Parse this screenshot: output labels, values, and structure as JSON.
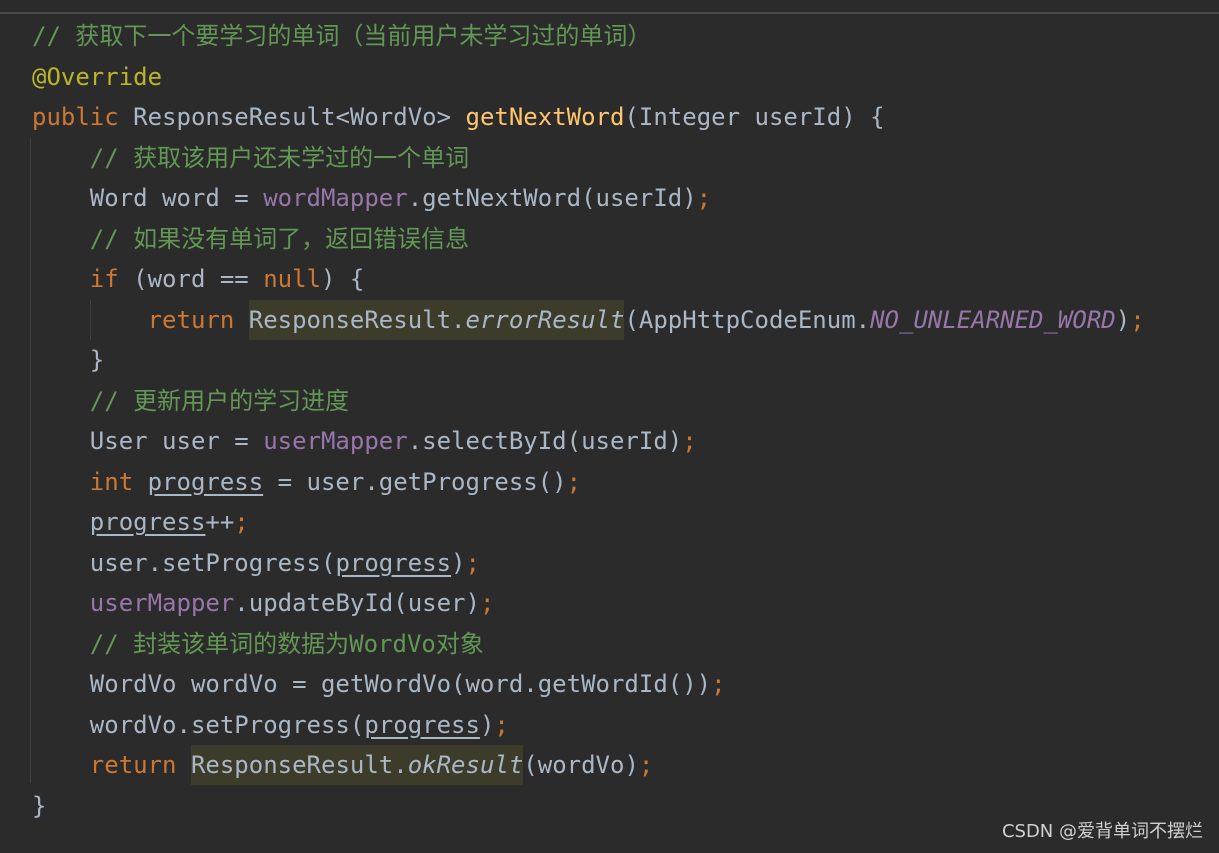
{
  "colors": {
    "background": "#2b2b2b",
    "keyword": "#cc7832",
    "comment": "#629755",
    "annotation": "#bbb529",
    "method_decl": "#ffc66d",
    "field": "#9876aa",
    "text": "#a9b7c6"
  },
  "code_lines": [
    [
      {
        "t": "// 获取下一个要学习的单词（当前用户未学习过的单词）",
        "c": "cm"
      }
    ],
    [
      {
        "t": "@Override",
        "c": "an"
      }
    ],
    [
      {
        "t": "public ",
        "c": "kw"
      },
      {
        "t": "ResponseResult<WordVo> "
      },
      {
        "t": "getNextWord",
        "c": "fn"
      },
      {
        "t": "(Integer userId) {"
      }
    ],
    [
      {
        "t": "    "
      },
      {
        "t": "// 获取该用户还未学过的一个单词",
        "c": "cm"
      }
    ],
    [
      {
        "t": "    Word word = "
      },
      {
        "t": "wordMapper",
        "c": "fld"
      },
      {
        "t": ".getNextWord(userId)"
      },
      {
        "t": ";",
        "c": "sm"
      }
    ],
    [
      {
        "t": "    "
      },
      {
        "t": "// 如果没有单词了，返回错误信息",
        "c": "cm"
      }
    ],
    [
      {
        "t": "    "
      },
      {
        "t": "if ",
        "c": "kw"
      },
      {
        "t": "(word == "
      },
      {
        "t": "null",
        "c": "kw"
      },
      {
        "t": ") {"
      }
    ],
    [
      {
        "t": "        "
      },
      {
        "t": "return ",
        "c": "kw"
      },
      {
        "t": "ResponseResult.",
        "c": "hl"
      },
      {
        "t": "errorResult",
        "c": "hl it"
      },
      {
        "t": "(AppHttpCodeEnum."
      },
      {
        "t": "NO_UNLEARNED_WORD",
        "c": "fld it"
      },
      {
        "t": ")"
      },
      {
        "t": ";",
        "c": "sm"
      }
    ],
    [
      {
        "t": "    }"
      }
    ],
    [
      {
        "t": "    "
      },
      {
        "t": "// 更新用户的学习进度",
        "c": "cm"
      }
    ],
    [
      {
        "t": "    User user = "
      },
      {
        "t": "userMapper",
        "c": "fld"
      },
      {
        "t": ".selectById(userId)"
      },
      {
        "t": ";",
        "c": "sm"
      }
    ],
    [
      {
        "t": "    "
      },
      {
        "t": "int ",
        "c": "kw"
      },
      {
        "t": "progress",
        "c": "ul"
      },
      {
        "t": " = user.getProgress()"
      },
      {
        "t": ";",
        "c": "sm"
      }
    ],
    [
      {
        "t": "    "
      },
      {
        "t": "progress",
        "c": "ul"
      },
      {
        "t": "++"
      },
      {
        "t": ";",
        "c": "sm"
      }
    ],
    [
      {
        "t": "    user.setProgress("
      },
      {
        "t": "progress",
        "c": "ul"
      },
      {
        "t": ")"
      },
      {
        "t": ";",
        "c": "sm"
      }
    ],
    [
      {
        "t": "    "
      },
      {
        "t": "userMapper",
        "c": "fld"
      },
      {
        "t": ".updateById(user)"
      },
      {
        "t": ";",
        "c": "sm"
      }
    ],
    [
      {
        "t": "    "
      },
      {
        "t": "// 封装该单词的数据为WordVo对象",
        "c": "cm"
      }
    ],
    [
      {
        "t": "    WordVo wordVo = getWordVo(word.getWordId())"
      },
      {
        "t": ";",
        "c": "sm"
      }
    ],
    [
      {
        "t": "    wordVo.setProgress("
      },
      {
        "t": "progress",
        "c": "ul"
      },
      {
        "t": ")"
      },
      {
        "t": ";",
        "c": "sm"
      }
    ],
    [
      {
        "t": "    "
      },
      {
        "t": "return ",
        "c": "kw"
      },
      {
        "t": "ResponseResult.",
        "c": "hl"
      },
      {
        "t": "okResult",
        "c": "hl it"
      },
      {
        "t": "(wordVo)"
      },
      {
        "t": ";",
        "c": "sm"
      }
    ],
    [
      {
        "t": "}"
      }
    ]
  ],
  "watermark": "CSDN @爱背单词不摆烂"
}
